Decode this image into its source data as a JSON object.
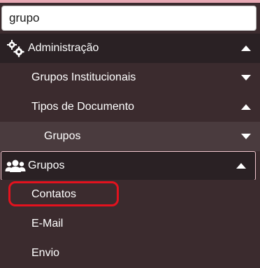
{
  "search": {
    "value": "grupo"
  },
  "menu": {
    "administracao": {
      "label": "Administração",
      "icon": "gears-icon",
      "state": "expanded"
    },
    "grupos_institucionais": {
      "label": "Grupos Institucionais",
      "state": "collapsed"
    },
    "tipos_documento": {
      "label": "Tipos de Documento",
      "state": "expanded"
    },
    "tipos_documento_grupos": {
      "label": "Grupos",
      "state": "collapsed"
    },
    "grupos": {
      "label": "Grupos",
      "icon": "users-icon",
      "state": "expanded"
    },
    "contatos": {
      "label": "Contatos"
    },
    "email": {
      "label": "E-Mail"
    },
    "envio": {
      "label": "Envio"
    }
  },
  "colors": {
    "accent_bar": "#e7a9b4",
    "highlight_ring": "#e3121e",
    "text": "#ffffff"
  }
}
